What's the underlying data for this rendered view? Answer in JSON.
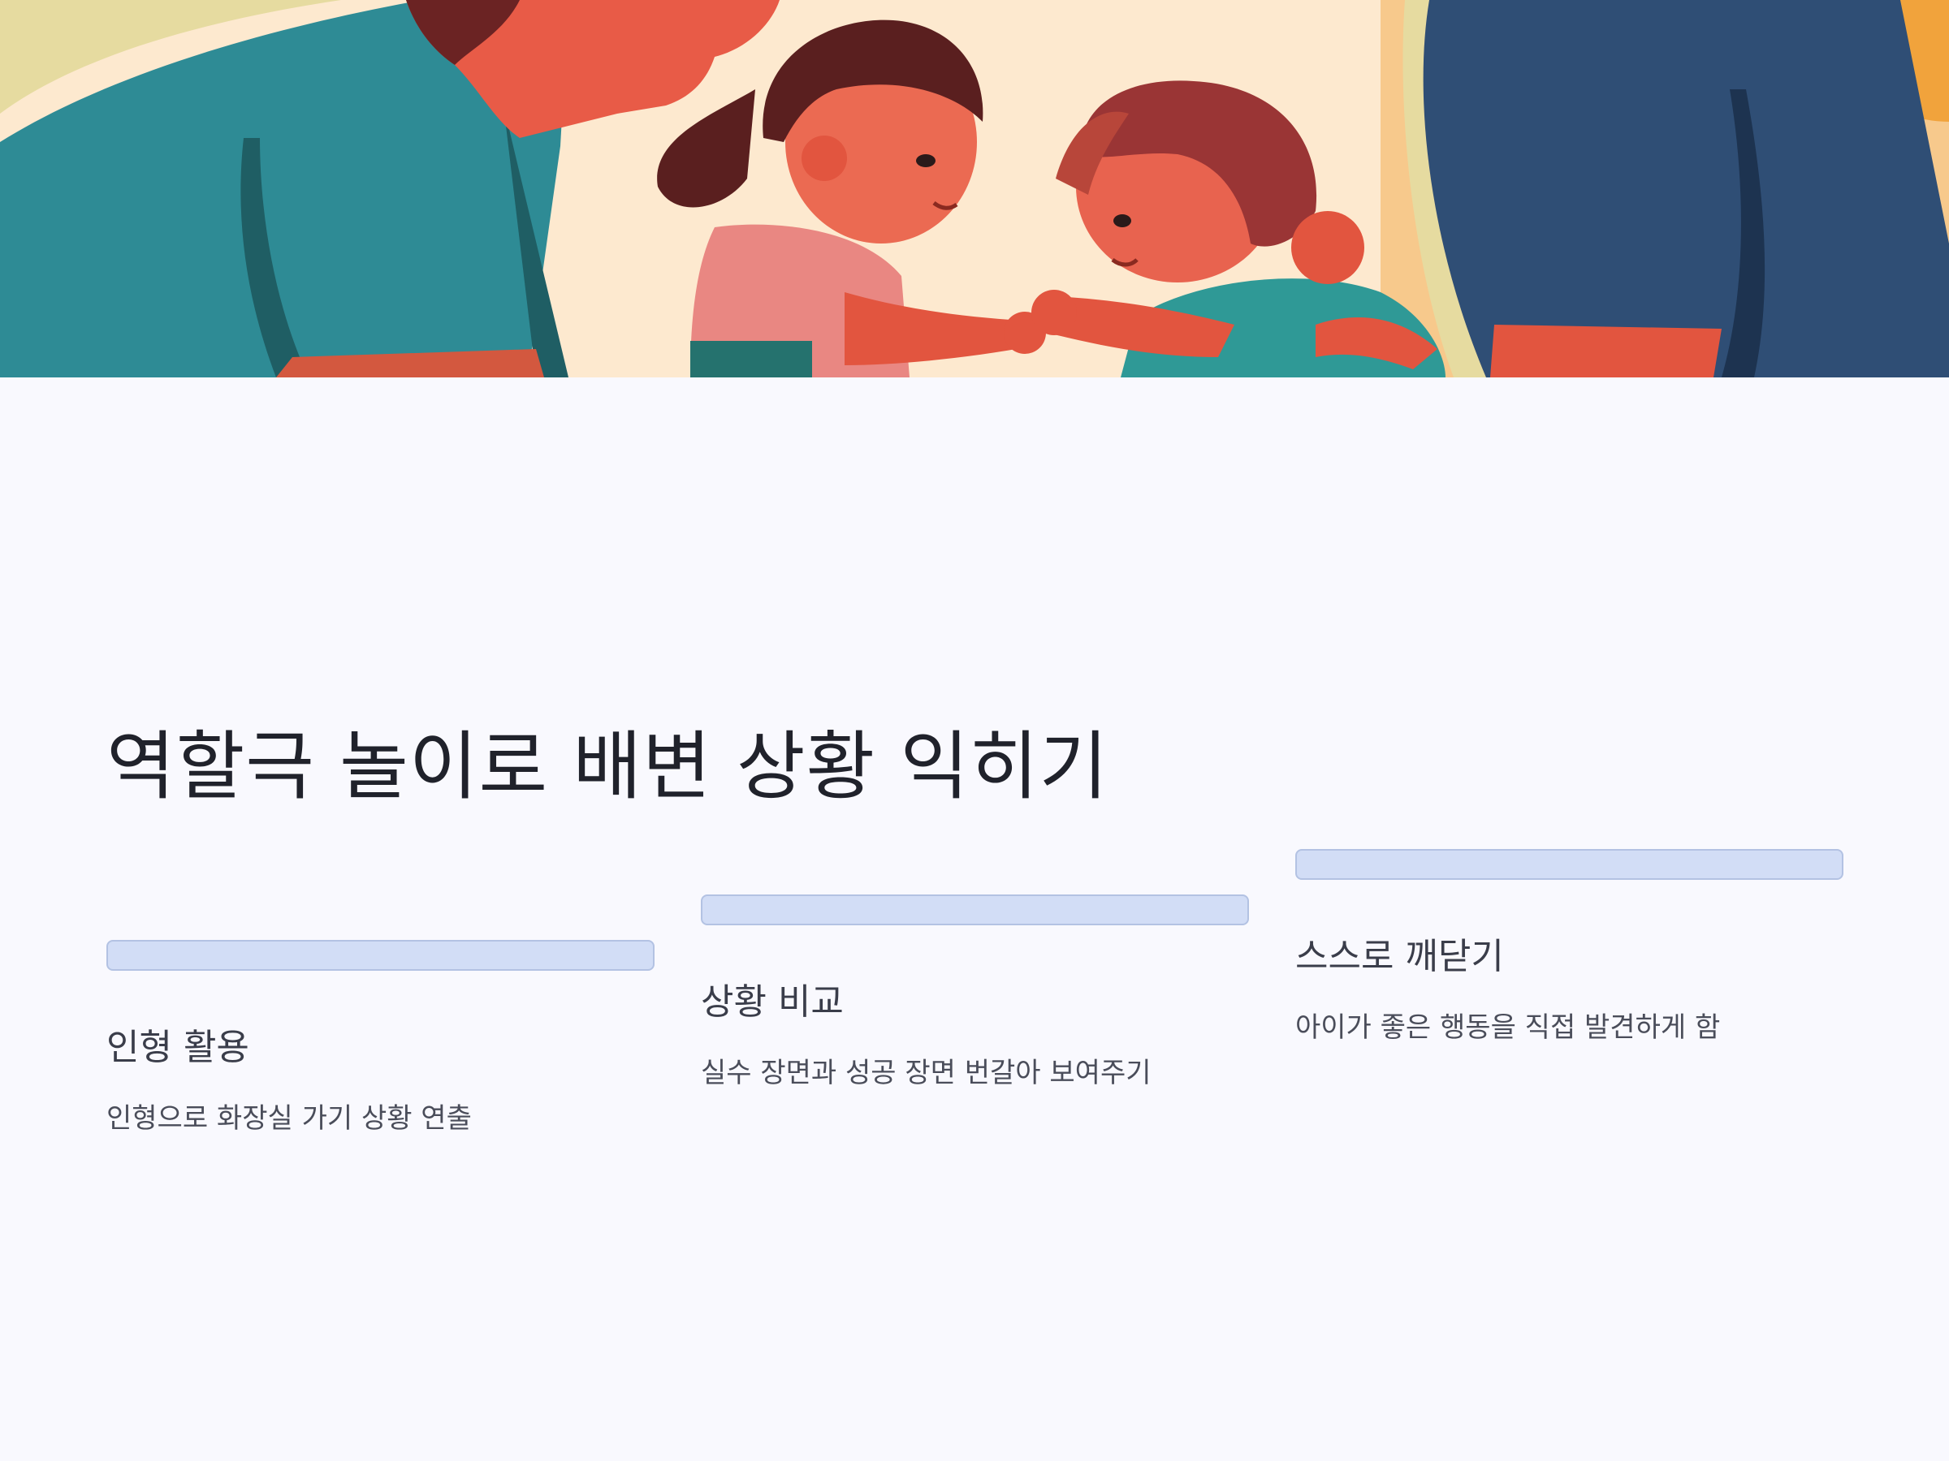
{
  "hero": {
    "image": "family-role-play-illustration"
  },
  "title": "역할극 놀이로 배변 상황 익히기",
  "steps": [
    {
      "heading": "인형 활용",
      "desc": "인형으로 화장실 가기 상황 연출"
    },
    {
      "heading": "상황 비교",
      "desc": "실수 장면과 성공 장면 번갈아 보여주기"
    },
    {
      "heading": "스스로 깨닫기",
      "desc": "아이가 좋은 행동을 직접 발견하게 함"
    }
  ],
  "colors": {
    "background": "#f9f9fe",
    "bar_fill": "#d2ddf6",
    "bar_border": "#b3c2e3",
    "title": "#20222b"
  }
}
